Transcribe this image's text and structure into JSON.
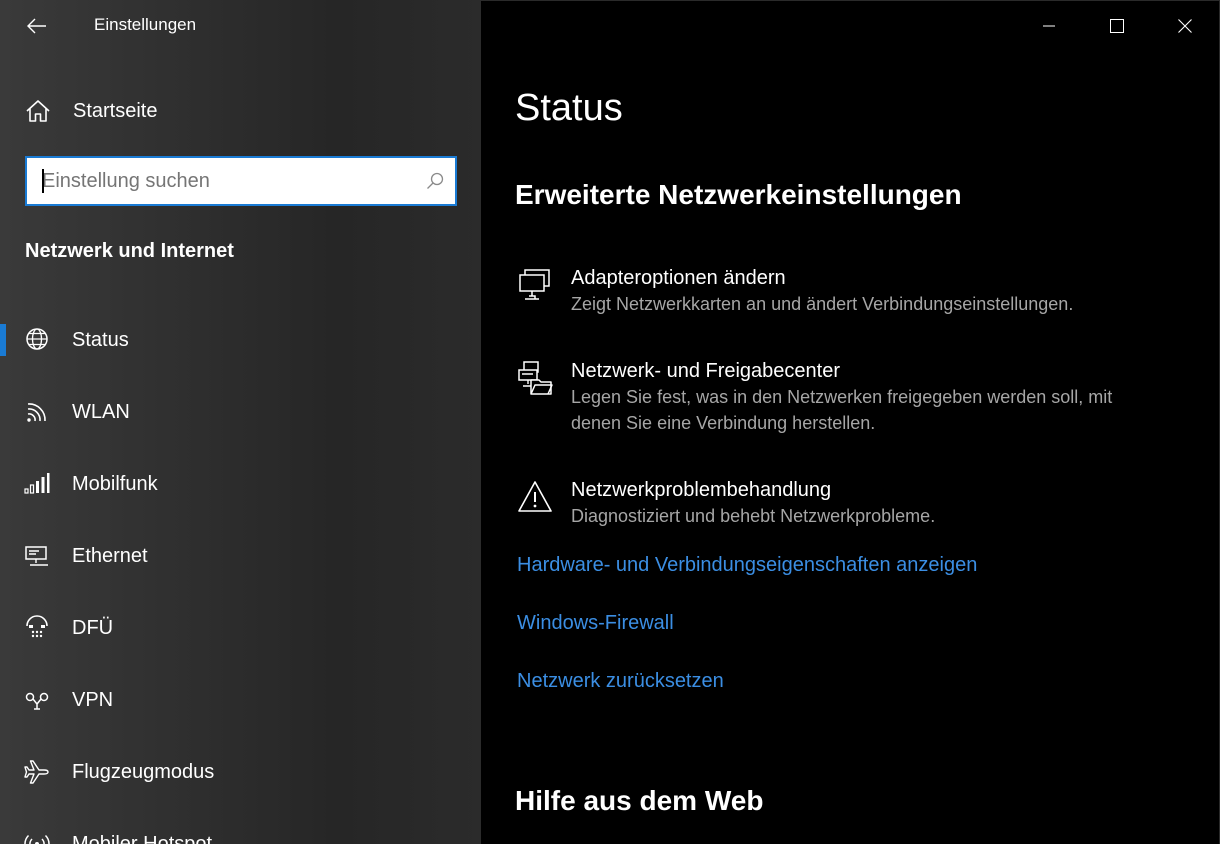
{
  "window": {
    "title": "Einstellungen"
  },
  "sidebar": {
    "home_label": "Startseite",
    "search_placeholder": "Einstellung suchen",
    "section_heading": "Netzwerk und Internet",
    "items": [
      {
        "label": "Status",
        "icon": "globe-icon",
        "selected": true
      },
      {
        "label": "WLAN",
        "icon": "wifi-icon"
      },
      {
        "label": "Mobilfunk",
        "icon": "cellular-icon"
      },
      {
        "label": "Ethernet",
        "icon": "ethernet-icon"
      },
      {
        "label": "DFÜ",
        "icon": "dialup-icon"
      },
      {
        "label": "VPN",
        "icon": "vpn-icon"
      },
      {
        "label": "Flugzeugmodus",
        "icon": "airplane-icon"
      },
      {
        "label": "Mobiler Hotspot",
        "icon": "hotspot-icon"
      }
    ]
  },
  "main": {
    "title": "Status",
    "advanced_heading": "Erweiterte Netzwerkeinstellungen",
    "options": [
      {
        "title": "Adapteroptionen ändern",
        "description": "Zeigt Netzwerkkarten an und ändert Verbindungseinstellungen.",
        "icon": "network-adapter-icon"
      },
      {
        "title": "Netzwerk- und Freigabecenter",
        "description": "Legen Sie fest, was in den Netzwerken freigegeben werden soll, mit denen Sie eine Verbindung herstellen.",
        "icon": "sharing-center-icon"
      },
      {
        "title": "Netzwerkproblembehandlung",
        "description": "Diagnostiziert und behebt Netzwerkprobleme.",
        "icon": "warning-icon"
      }
    ],
    "links": [
      "Hardware- und Verbindungseigenschaften anzeigen",
      "Windows-Firewall",
      "Netzwerk zurücksetzen"
    ],
    "help_heading": "Hilfe aus dem Web"
  },
  "colors": {
    "accent": "#1a7bd4",
    "link": "#3b8ee3",
    "background": "#000000",
    "sidebar": "#2d2d2d"
  }
}
